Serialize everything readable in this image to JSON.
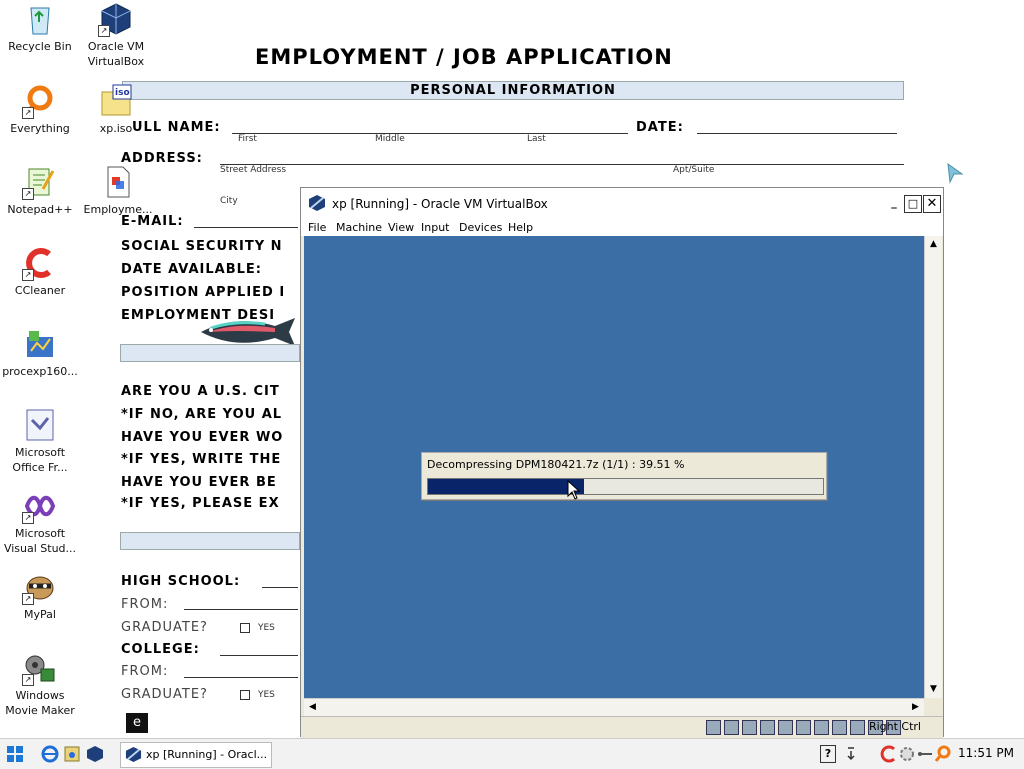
{
  "desktop": {
    "icons": [
      {
        "label": "Recycle Bin"
      },
      {
        "label": "Oracle VM\nVirtualBox"
      },
      {
        "label": "Everything"
      },
      {
        "label": "xp.iso"
      },
      {
        "label": "Notepad++"
      },
      {
        "label": "Employme..."
      },
      {
        "label": "CCleaner"
      },
      {
        "label": "procexp160..."
      },
      {
        "label": "Microsoft\nOffice Fr..."
      },
      {
        "label": "Microsoft\nVisual Stud..."
      },
      {
        "label": "MyPal"
      },
      {
        "label": "Windows\nMovie Maker"
      }
    ],
    "iso_badge": "iso"
  },
  "wallpaper": {
    "title": "EMPLOYMENT / JOB APPLICATION",
    "section_personal": "PERSONAL INFORMATION",
    "full_name": "ULL NAME:",
    "first": "First",
    "middle": "Middle",
    "last": "Last",
    "date": "DATE:",
    "address": "ADDRESS:",
    "street": "Street Address",
    "apt": "Apt/Suite",
    "city": "City",
    "email": "E-MAIL:",
    "ssn": "SOCIAL SECURITY N",
    "date_available": "DATE AVAILABLE:",
    "position": "POSITION APPLIED I",
    "employment": "EMPLOYMENT DESI",
    "us_citizen": "ARE YOU A U.S. CIT",
    "if_no": "*IF NO, ARE YOU AL",
    "have_you_worked": "HAVE YOU EVER WO",
    "if_yes_write": "*IF YES, WRITE THE",
    "have_you_been": "HAVE YOU EVER BE",
    "if_yes_explain": "*IF YES, PLEASE EX",
    "high_school": "HIGH SCHOOL:",
    "from": "FROM:",
    "graduate": "GRADUATE?",
    "yes": "YES",
    "college": "COLLEGE:",
    "from2": "FROM:",
    "graduate2": "GRADUATE?",
    "yes2": "YES"
  },
  "vbox": {
    "title": "xp [Running] - Oracle VM VirtualBox",
    "menu": [
      "File",
      "Machine",
      "View",
      "Input",
      "Devices",
      "Help"
    ],
    "host_key": "Right Ctrl",
    "progress_text": "Decompressing DPM180421.7z  (1/1) : 39.51 %",
    "progress_fraction": 0.3951
  },
  "taskbar": {
    "task_label": "xp [Running] - Oracl...",
    "clock": "11:51 PM"
  },
  "colors": {
    "vm_screen": "#3a6ea5",
    "progress_fill": "#0a246a"
  }
}
